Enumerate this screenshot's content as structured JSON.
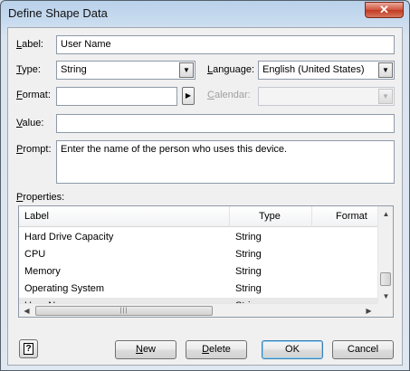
{
  "window": {
    "title": "Define Shape Data",
    "close_glyph": "✕"
  },
  "form": {
    "label": {
      "label_prefix": "L",
      "label_rest": "abel:",
      "value": "User Name"
    },
    "type": {
      "label_prefix": "T",
      "label_rest": "ype:",
      "value": "String"
    },
    "language": {
      "label_prefix": "L",
      "label_rest": "anguage:",
      "value": "English (United States)"
    },
    "format": {
      "label_prefix": "F",
      "label_rest": "ormat:",
      "value": ""
    },
    "calendar": {
      "label_prefix": "C",
      "label_rest": "alendar:",
      "value": ""
    },
    "value": {
      "label_prefix": "V",
      "label_rest": "alue:",
      "value": ""
    },
    "prompt": {
      "label_prefix": "P",
      "label_rest": "rompt:",
      "value": "Enter the name of the person who uses this device."
    }
  },
  "properties": {
    "label_prefix": "P",
    "label_rest": "roperties:",
    "columns": [
      "Label",
      "Type",
      "Format"
    ],
    "rows": [
      {
        "label": "Hard Drive Capacity",
        "type": "String"
      },
      {
        "label": "CPU",
        "type": "String"
      },
      {
        "label": "Memory",
        "type": "String"
      },
      {
        "label": "Operating System",
        "type": "String"
      },
      {
        "label": "User Name",
        "type": "String"
      }
    ],
    "selected_row": "User Name"
  },
  "buttons": {
    "new": {
      "prefix": "N",
      "rest": "ew"
    },
    "delete": {
      "prefix": "D",
      "rest": "elete"
    },
    "ok": "OK",
    "cancel": "Cancel",
    "help_glyph": "?"
  },
  "icons": {
    "dropdown": "▼",
    "more": "▶",
    "scroll_up": "▲",
    "scroll_down": "▼",
    "scroll_left": "◀",
    "scroll_right": "▶",
    "grip": "|||"
  },
  "colors": {
    "close_button": "#c8452c",
    "default_button_border": "#3c7fb1"
  }
}
